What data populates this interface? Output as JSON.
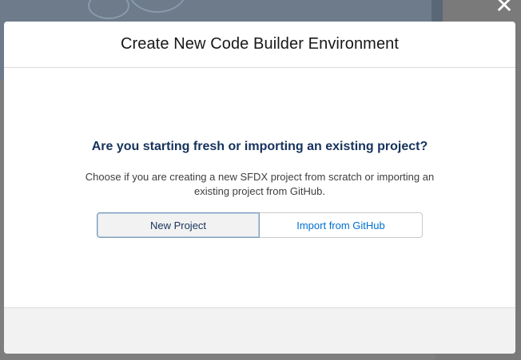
{
  "modal": {
    "title": "Create New Code Builder Environment",
    "question": "Are you starting fresh or importing an existing project?",
    "description": "Choose if you are creating a new SFDX project from scratch or importing an existing project from GitHub.",
    "options": [
      {
        "label": "New Project",
        "selected": true
      },
      {
        "label": "Import from GitHub",
        "selected": false
      }
    ]
  },
  "close_icon": "close-icon",
  "colors": {
    "accent": "#0070d2",
    "heading": "#16325c",
    "backdrop": "#7e7e7e",
    "footer": "#f3f2f2"
  }
}
